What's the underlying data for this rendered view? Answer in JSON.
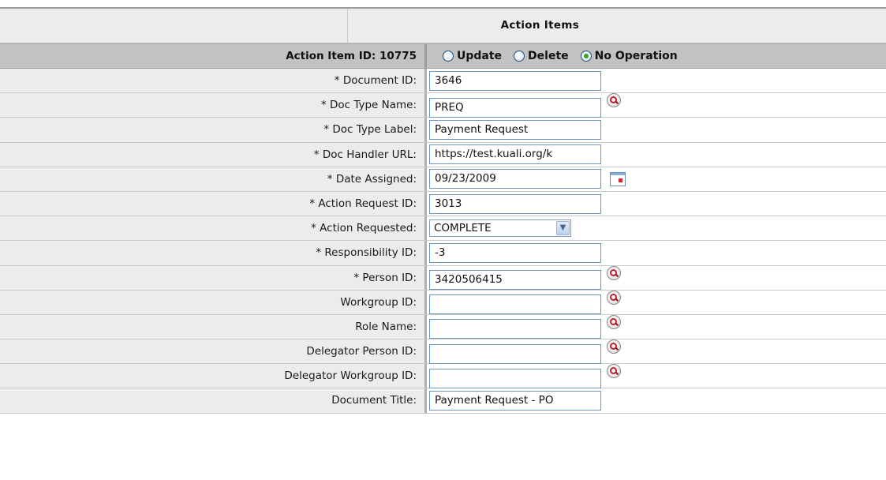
{
  "section": {
    "title": "Action Items"
  },
  "item": {
    "id_label": "Action Item ID: 10775",
    "operations": [
      {
        "label": "Update",
        "checked": false
      },
      {
        "label": "Delete",
        "checked": false
      },
      {
        "label": "No Operation",
        "checked": true
      }
    ]
  },
  "fields": [
    {
      "label": "* Document ID:",
      "value": "3646",
      "control": "text"
    },
    {
      "label": "* Doc Type Name:",
      "value": "PREQ",
      "control": "text-lookup"
    },
    {
      "label": "* Doc Type Label:",
      "value": "Payment Request",
      "control": "text"
    },
    {
      "label": "* Doc Handler URL:",
      "value": "https://test.kuali.org/k",
      "control": "text"
    },
    {
      "label": "* Date Assigned:",
      "value": "09/23/2009",
      "control": "date"
    },
    {
      "label": "* Action Request ID:",
      "value": "3013",
      "control": "text"
    },
    {
      "label": "* Action Requested:",
      "value": "COMPLETE",
      "control": "select"
    },
    {
      "label": "* Responsibility ID:",
      "value": "-3",
      "control": "text"
    },
    {
      "label": "* Person ID:",
      "value": "3420506415",
      "control": "text-lookup"
    },
    {
      "label": "Workgroup ID:",
      "value": "",
      "control": "text-lookup"
    },
    {
      "label": "Role Name:",
      "value": "",
      "control": "text-lookup"
    },
    {
      "label": "Delegator Person ID:",
      "value": "",
      "control": "text-lookup"
    },
    {
      "label": "Delegator Workgroup ID:",
      "value": "",
      "control": "text-lookup"
    },
    {
      "label": "Document Title:",
      "value": "Payment Request - PO",
      "control": "text"
    }
  ],
  "icons": {
    "lookup": "magnifier-lookup-icon",
    "calendar": "calendar-icon",
    "dropdown": "chevron-down-icon"
  },
  "colors": {
    "label_bg": "#ececec",
    "id_row_bg": "#c2c2c2",
    "input_border": "#6e95bd",
    "radio_checked": "#37a12a",
    "lookup_red": "#c0202a"
  }
}
